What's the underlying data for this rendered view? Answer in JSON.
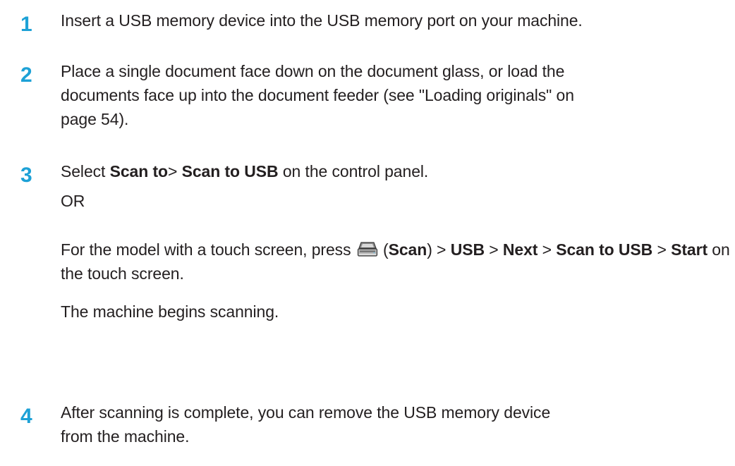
{
  "steps": [
    {
      "number": "1",
      "text": "Insert a USB memory device into the USB memory port on your machine."
    },
    {
      "number": "2",
      "line1": "Place a single document face down on the document glass, or load the",
      "line2": "documents face up into the document feeder (see \"Loading originals\" on",
      "line3": "page 54)."
    },
    {
      "number": "3",
      "select_prefix": "Select ",
      "select_bold1": "Scan to",
      "select_sep": "> ",
      "select_bold2": "Scan to USB",
      "select_suffix": " on the control panel.",
      "or_text": "OR",
      "touch_prefix": "For the model with a touch screen, press ",
      "touch_icon": "scanner-icon",
      "touch_open": " (",
      "touch_scan": "Scan",
      "touch_close": ") > ",
      "touch_usb": "USB",
      "touch_sep1": " > ",
      "touch_next": "Next",
      "touch_sep2": " > ",
      "touch_scan_to_usb": "Scan to USB",
      "touch_sep3": " > ",
      "touch_start": "Start",
      "touch_suffix": " on the touch screen.",
      "begins_text": "The machine begins scanning."
    },
    {
      "number": "4",
      "line1": "After scanning is complete, you can remove the USB memory device",
      "line2": "from the machine."
    }
  ],
  "colors": {
    "step_number": "#1da1d6",
    "body_text": "#231f20"
  }
}
